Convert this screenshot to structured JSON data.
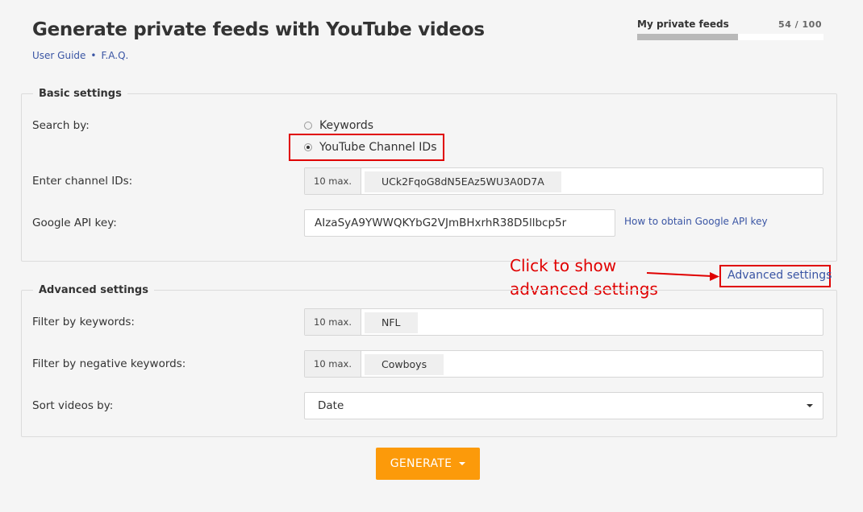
{
  "header": {
    "title": "Generate private feeds with YouTube videos",
    "links": [
      "User Guide",
      "F.A.Q."
    ],
    "separator": "•"
  },
  "quota": {
    "label": "My private feeds",
    "count_text": "54 / 100",
    "used_fraction": 0.54
  },
  "basic": {
    "legend": "Basic settings",
    "search_label": "Search by:",
    "options": [
      {
        "label": "Keywords",
        "selected": false
      },
      {
        "label": "YouTube Channel IDs",
        "selected": true
      }
    ],
    "channel_label": "Enter channel IDs:",
    "channel_max": "10 max.",
    "channel_tags": [
      "UCk2FqoG8dN5EAz5WU3A0D7A"
    ],
    "api_label": "Google API key:",
    "api_value": "AIzaSyA9YWWQKYbG2VJmBHxrhR38D5llbcp5r",
    "api_help": "How to obtain Google API key"
  },
  "annotation": {
    "callout_line1": "Click to show",
    "callout_line2": "advanced settings",
    "color": "#e00000"
  },
  "advanced": {
    "link": "Advanced settings",
    "legend": "Advanced settings",
    "filter_label": "Filter by keywords:",
    "filter_max": "10 max.",
    "filter_tags": [
      "NFL"
    ],
    "neg_label": "Filter by negative keywords:",
    "neg_max": "10 max.",
    "neg_tags": [
      "Cowboys"
    ],
    "sort_label": "Sort videos by:",
    "sort_value": "Date"
  },
  "actions": {
    "generate": "GENERATE",
    "generate_color": "#fc9a0a"
  }
}
